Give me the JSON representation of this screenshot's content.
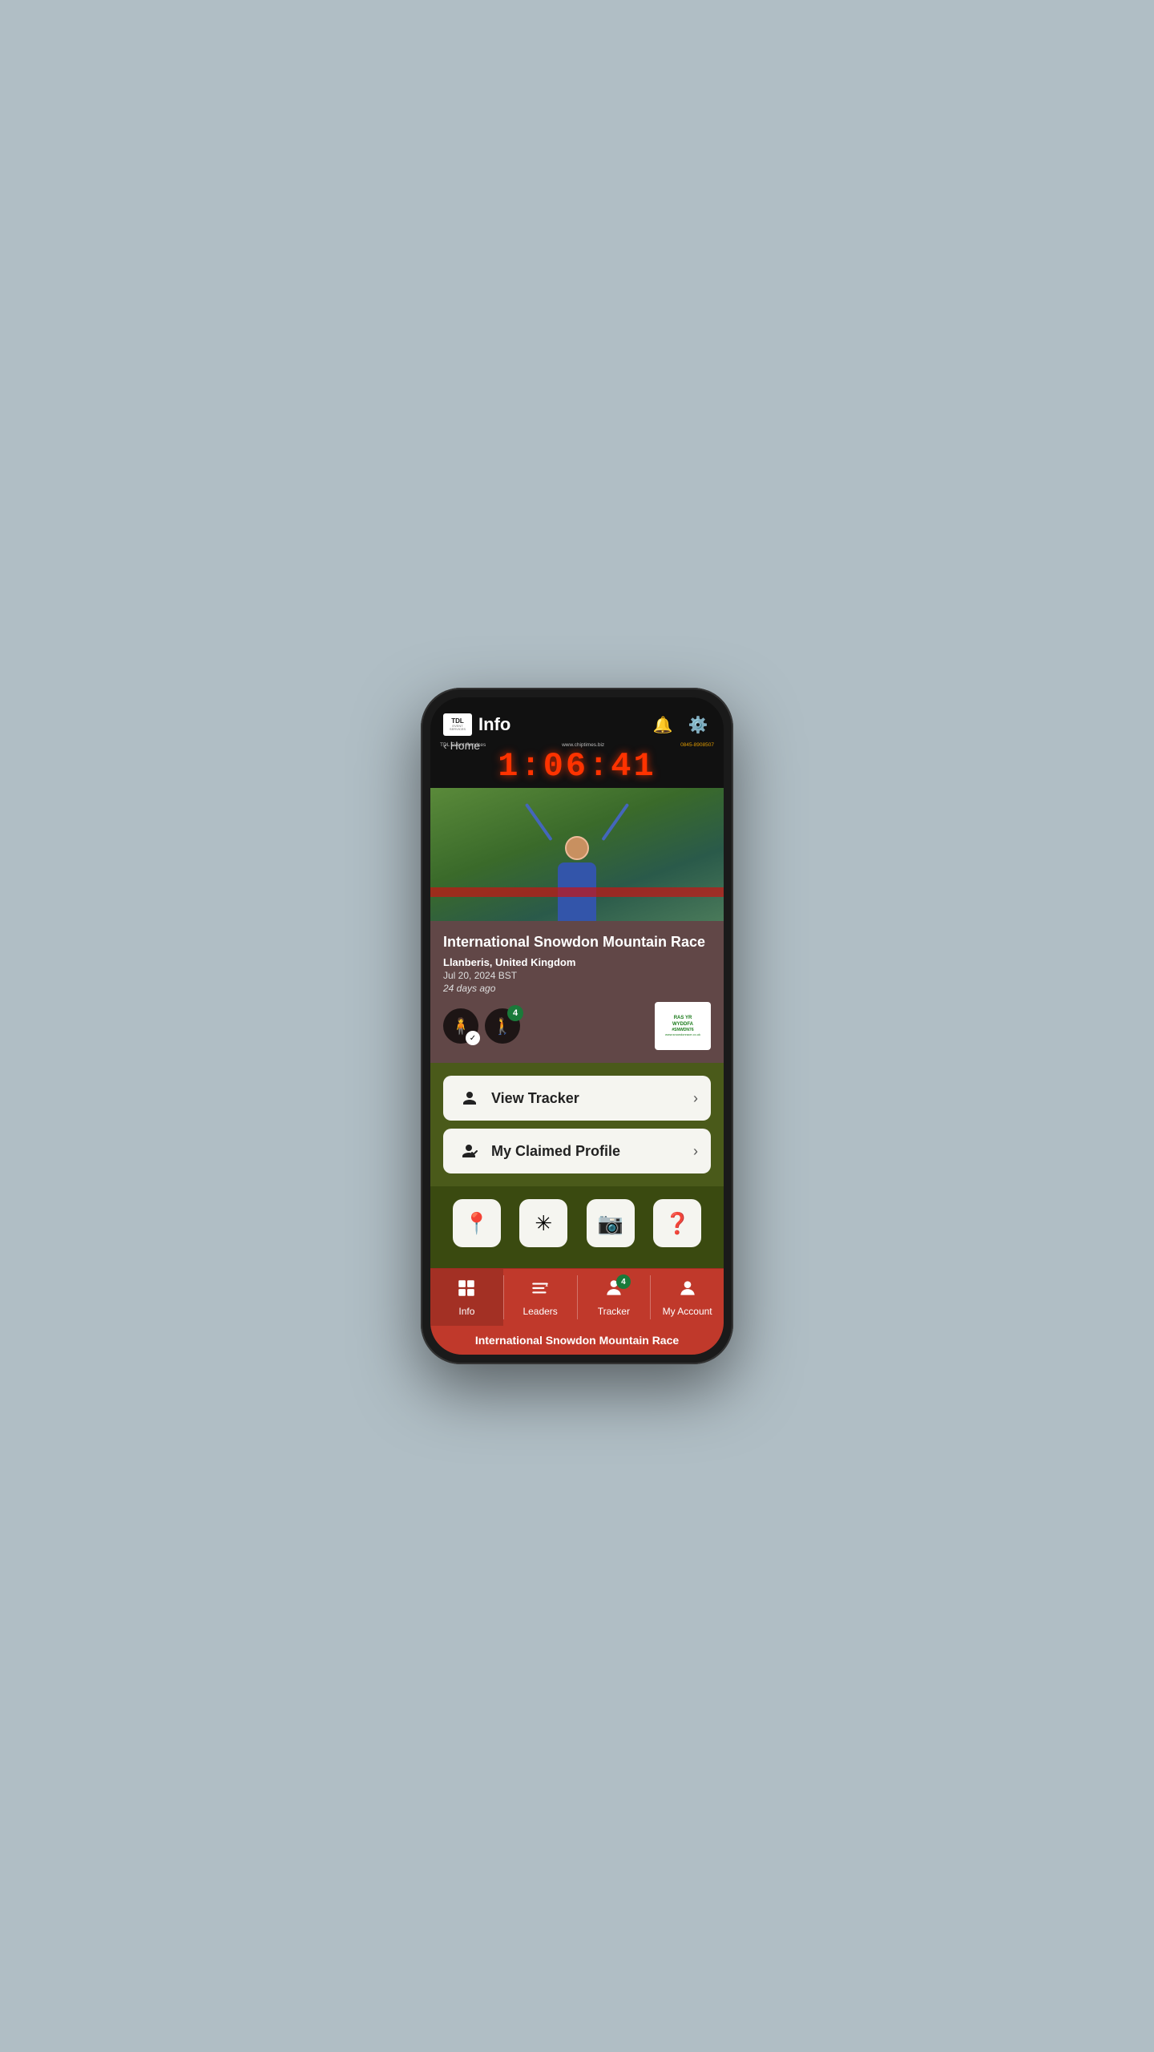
{
  "app": {
    "name": "TDL Event Services",
    "logo_text": "TDL",
    "logo_sub": "EVENT SERVICES"
  },
  "header": {
    "title": "Info",
    "breadcrumb": "Home"
  },
  "scoreboard": {
    "brand_left": "TDL Event Services",
    "website": "www.chiptimes.biz",
    "phone": "0845-8908507",
    "time": "1:06:41"
  },
  "race": {
    "name": "International Snowdon Mountain Race",
    "location": "Llanberis, United Kingdom",
    "date": "Jul 20, 2024 BST",
    "time_ago": "24 days ago",
    "logo_text": "RAS YR WYDDFA",
    "logo_hashtag": "#SNWDN76",
    "logo_website": "www.snowdonrace.co.uk",
    "tracker_count": "4"
  },
  "buttons": {
    "view_tracker_label": "View Tracker",
    "my_claimed_profile_label": "My Claimed Profile"
  },
  "quick_actions": {
    "pin_icon": "📍",
    "star_icon": "✳",
    "camera_icon": "📷",
    "help_icon": "❓"
  },
  "tabs": [
    {
      "id": "info",
      "label": "Info",
      "icon": "grid",
      "active": true
    },
    {
      "id": "leaders",
      "label": "Leaders",
      "icon": "list",
      "active": false
    },
    {
      "id": "tracker",
      "label": "Tracker",
      "icon": "person",
      "active": false,
      "badge": "4"
    },
    {
      "id": "my_account",
      "label": "My Account",
      "icon": "user",
      "active": false
    }
  ],
  "bottom_label": "International Snowdon Mountain Race"
}
